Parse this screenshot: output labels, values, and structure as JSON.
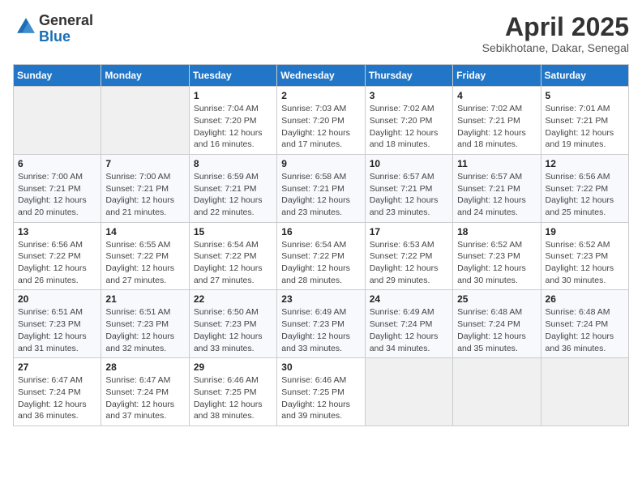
{
  "header": {
    "logo_general": "General",
    "logo_blue": "Blue",
    "month_title": "April 2025",
    "subtitle": "Sebikhotane, Dakar, Senegal"
  },
  "weekdays": [
    "Sunday",
    "Monday",
    "Tuesday",
    "Wednesday",
    "Thursday",
    "Friday",
    "Saturday"
  ],
  "weeks": [
    [
      {
        "day": "",
        "info": ""
      },
      {
        "day": "",
        "info": ""
      },
      {
        "day": "1",
        "info": "Sunrise: 7:04 AM\nSunset: 7:20 PM\nDaylight: 12 hours and 16 minutes."
      },
      {
        "day": "2",
        "info": "Sunrise: 7:03 AM\nSunset: 7:20 PM\nDaylight: 12 hours and 17 minutes."
      },
      {
        "day": "3",
        "info": "Sunrise: 7:02 AM\nSunset: 7:20 PM\nDaylight: 12 hours and 18 minutes."
      },
      {
        "day": "4",
        "info": "Sunrise: 7:02 AM\nSunset: 7:21 PM\nDaylight: 12 hours and 18 minutes."
      },
      {
        "day": "5",
        "info": "Sunrise: 7:01 AM\nSunset: 7:21 PM\nDaylight: 12 hours and 19 minutes."
      }
    ],
    [
      {
        "day": "6",
        "info": "Sunrise: 7:00 AM\nSunset: 7:21 PM\nDaylight: 12 hours and 20 minutes."
      },
      {
        "day": "7",
        "info": "Sunrise: 7:00 AM\nSunset: 7:21 PM\nDaylight: 12 hours and 21 minutes."
      },
      {
        "day": "8",
        "info": "Sunrise: 6:59 AM\nSunset: 7:21 PM\nDaylight: 12 hours and 22 minutes."
      },
      {
        "day": "9",
        "info": "Sunrise: 6:58 AM\nSunset: 7:21 PM\nDaylight: 12 hours and 23 minutes."
      },
      {
        "day": "10",
        "info": "Sunrise: 6:57 AM\nSunset: 7:21 PM\nDaylight: 12 hours and 23 minutes."
      },
      {
        "day": "11",
        "info": "Sunrise: 6:57 AM\nSunset: 7:21 PM\nDaylight: 12 hours and 24 minutes."
      },
      {
        "day": "12",
        "info": "Sunrise: 6:56 AM\nSunset: 7:22 PM\nDaylight: 12 hours and 25 minutes."
      }
    ],
    [
      {
        "day": "13",
        "info": "Sunrise: 6:56 AM\nSunset: 7:22 PM\nDaylight: 12 hours and 26 minutes."
      },
      {
        "day": "14",
        "info": "Sunrise: 6:55 AM\nSunset: 7:22 PM\nDaylight: 12 hours and 27 minutes."
      },
      {
        "day": "15",
        "info": "Sunrise: 6:54 AM\nSunset: 7:22 PM\nDaylight: 12 hours and 27 minutes."
      },
      {
        "day": "16",
        "info": "Sunrise: 6:54 AM\nSunset: 7:22 PM\nDaylight: 12 hours and 28 minutes."
      },
      {
        "day": "17",
        "info": "Sunrise: 6:53 AM\nSunset: 7:22 PM\nDaylight: 12 hours and 29 minutes."
      },
      {
        "day": "18",
        "info": "Sunrise: 6:52 AM\nSunset: 7:23 PM\nDaylight: 12 hours and 30 minutes."
      },
      {
        "day": "19",
        "info": "Sunrise: 6:52 AM\nSunset: 7:23 PM\nDaylight: 12 hours and 30 minutes."
      }
    ],
    [
      {
        "day": "20",
        "info": "Sunrise: 6:51 AM\nSunset: 7:23 PM\nDaylight: 12 hours and 31 minutes."
      },
      {
        "day": "21",
        "info": "Sunrise: 6:51 AM\nSunset: 7:23 PM\nDaylight: 12 hours and 32 minutes."
      },
      {
        "day": "22",
        "info": "Sunrise: 6:50 AM\nSunset: 7:23 PM\nDaylight: 12 hours and 33 minutes."
      },
      {
        "day": "23",
        "info": "Sunrise: 6:49 AM\nSunset: 7:23 PM\nDaylight: 12 hours and 33 minutes."
      },
      {
        "day": "24",
        "info": "Sunrise: 6:49 AM\nSunset: 7:24 PM\nDaylight: 12 hours and 34 minutes."
      },
      {
        "day": "25",
        "info": "Sunrise: 6:48 AM\nSunset: 7:24 PM\nDaylight: 12 hours and 35 minutes."
      },
      {
        "day": "26",
        "info": "Sunrise: 6:48 AM\nSunset: 7:24 PM\nDaylight: 12 hours and 36 minutes."
      }
    ],
    [
      {
        "day": "27",
        "info": "Sunrise: 6:47 AM\nSunset: 7:24 PM\nDaylight: 12 hours and 36 minutes."
      },
      {
        "day": "28",
        "info": "Sunrise: 6:47 AM\nSunset: 7:24 PM\nDaylight: 12 hours and 37 minutes."
      },
      {
        "day": "29",
        "info": "Sunrise: 6:46 AM\nSunset: 7:25 PM\nDaylight: 12 hours and 38 minutes."
      },
      {
        "day": "30",
        "info": "Sunrise: 6:46 AM\nSunset: 7:25 PM\nDaylight: 12 hours and 39 minutes."
      },
      {
        "day": "",
        "info": ""
      },
      {
        "day": "",
        "info": ""
      },
      {
        "day": "",
        "info": ""
      }
    ]
  ]
}
